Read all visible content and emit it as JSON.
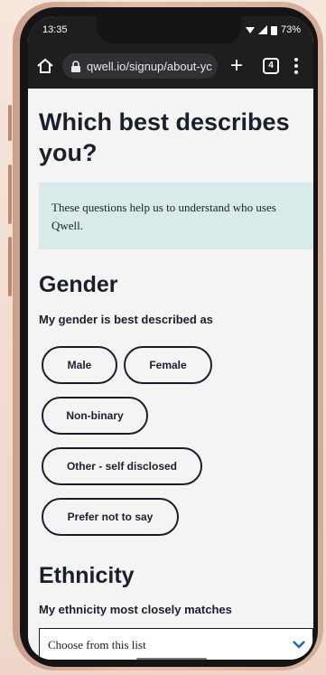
{
  "status_bar": {
    "time": "13:35",
    "battery": "73%"
  },
  "browser": {
    "url": "qwell.io/signup/about-yc",
    "tab_count": "4"
  },
  "page": {
    "title": "Which best describes you?",
    "info_text": "These questions help us to understand who uses Qwell."
  },
  "gender": {
    "heading": "Gender",
    "label": "My gender is best described as",
    "options": [
      "Male",
      "Female",
      "Non-binary",
      "Other - self disclosed",
      "Prefer not to say"
    ]
  },
  "ethnicity": {
    "heading": "Ethnicity",
    "label": "My ethnicity most closely matches",
    "select_value": "Choose from this list"
  },
  "colors": {
    "accent": "#d8ebea",
    "text": "#1b1f2b",
    "chevron": "#1f5fbf"
  }
}
